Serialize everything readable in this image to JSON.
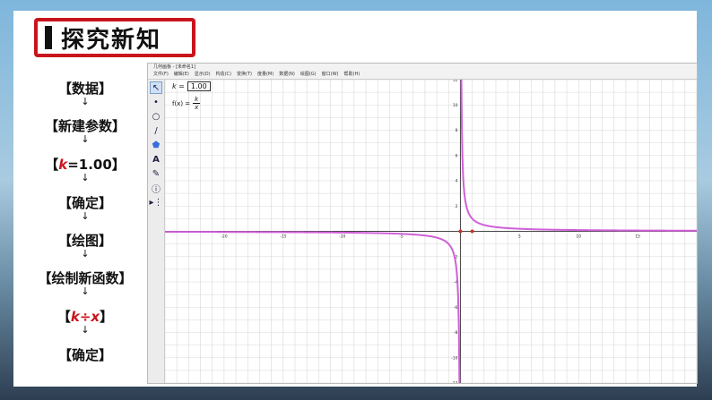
{
  "section_title": "探究新知",
  "steps": [
    {
      "label": "【数据】"
    },
    {
      "label": "【新建参数】"
    },
    {
      "label_pre": "【",
      "label_var": "k",
      "label_post": "=1.00】"
    },
    {
      "label": "【确定】"
    },
    {
      "label": "【绘图】"
    },
    {
      "label": "【绘制新函数】"
    },
    {
      "label_pre": "【",
      "label_var": "k÷x",
      "label_post": "】"
    },
    {
      "label": "【确定】"
    }
  ],
  "app": {
    "title": "几何画板 - [未命名1]",
    "menu": [
      "文件(F)",
      "编辑(E)",
      "显示(D)",
      "构造(C)",
      "变换(T)",
      "度量(M)",
      "数据(N)",
      "绘图(G)",
      "窗口(W)",
      "帮助(H)"
    ],
    "tools": [
      {
        "icon": "arrow-select-icon",
        "glyph": "↖",
        "active": true
      },
      {
        "icon": "point-icon",
        "glyph": "•"
      },
      {
        "icon": "circle-icon",
        "glyph": "○"
      },
      {
        "icon": "line-icon",
        "glyph": "/"
      },
      {
        "icon": "polygon-icon",
        "glyph": "⬟"
      },
      {
        "icon": "text-icon",
        "glyph": "A"
      },
      {
        "icon": "marker-icon",
        "glyph": "✎"
      },
      {
        "icon": "info-icon",
        "glyph": "ⓘ"
      },
      {
        "icon": "custom-tool-icon",
        "glyph": "▸⋮"
      }
    ],
    "parameter": {
      "name": "k =",
      "value": "1.00"
    },
    "function": {
      "label": "f(x) =",
      "numerator": "k",
      "denominator": "x"
    }
  },
  "chart_data": {
    "type": "line",
    "title": "",
    "xlabel": "",
    "ylabel": "",
    "xlim": [
      -25,
      20
    ],
    "ylim": [
      -12,
      12
    ],
    "grid": true,
    "x_ticks": [
      -20,
      -15,
      -10,
      -5,
      5,
      10,
      15
    ],
    "y_ticks": [
      -12,
      -10,
      -8,
      -6,
      -4,
      -2,
      2,
      4,
      6,
      8,
      10,
      12
    ],
    "series": [
      {
        "function": "f(x) = k/x",
        "k": 1.0,
        "color": "#d060d8"
      }
    ],
    "points": [
      {
        "x": 0,
        "y": 0,
        "color": "#cc3322"
      },
      {
        "x": 1,
        "y": 0,
        "color": "#cc3322"
      }
    ]
  },
  "colors": {
    "accent": "#c9141c",
    "curve": "#d060d8",
    "grid": "#d8d8d8"
  }
}
